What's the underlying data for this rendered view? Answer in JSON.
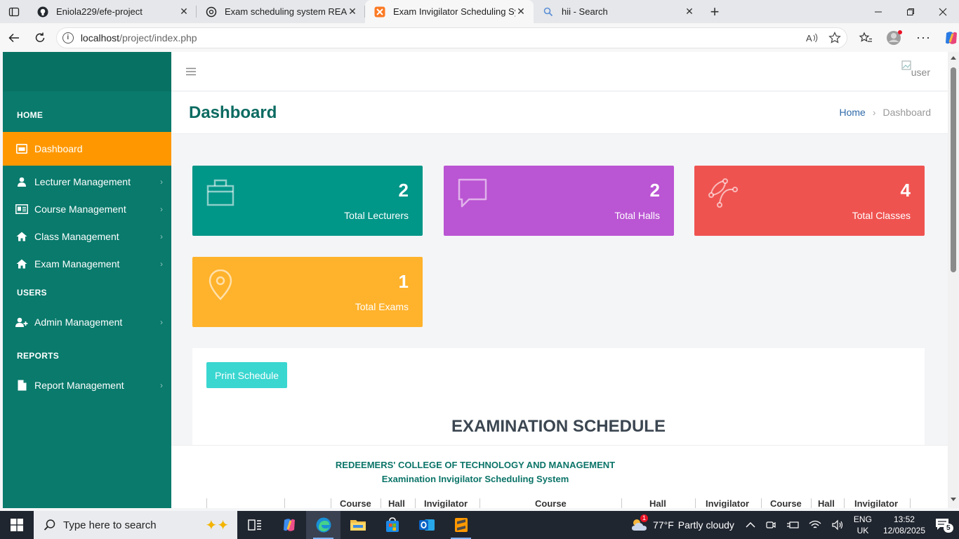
{
  "browser": {
    "tabs": [
      {
        "title": "Eniola229/efe-project",
        "icon": "github-icon"
      },
      {
        "title": "Exam scheduling system README",
        "icon": "openai-icon"
      },
      {
        "title": "Exam Invigilator Scheduling Syste",
        "icon": "xampp-icon",
        "active": true
      },
      {
        "title": "hii - Search",
        "icon": "search-icon"
      }
    ],
    "url_host": "localhost",
    "url_path": "/project/index.php"
  },
  "sidebar": {
    "sections": {
      "home": "HOME",
      "users": "USERS",
      "reports": "REPORTS"
    },
    "items": [
      {
        "label": "Dashboard",
        "icon": "dashboard-icon"
      },
      {
        "label": "Lecturer Management",
        "icon": "user-icon"
      },
      {
        "label": "Course Management",
        "icon": "id-card-icon"
      },
      {
        "label": "Class Management",
        "icon": "home-icon"
      },
      {
        "label": "Exam Management",
        "icon": "home-icon"
      },
      {
        "label": "Admin Management",
        "icon": "user-plus-icon"
      },
      {
        "label": "Report Management",
        "icon": "file-icon"
      }
    ],
    "active_color": "#ff9800",
    "bg_color": "#097a6c"
  },
  "topbar": {
    "avatar_alt": "user"
  },
  "header": {
    "title": "Dashboard",
    "breadcrumb_home": "Home",
    "breadcrumb_current": "Dashboard"
  },
  "stats": [
    {
      "value": "2",
      "label": "Total Lecturers",
      "color": "#009688",
      "icon": "briefcase-icon"
    },
    {
      "value": "2",
      "label": "Total Halls",
      "color": "#ba55d3",
      "icon": "chat-icon"
    },
    {
      "value": "4",
      "label": "Total Classes",
      "color": "#ef5350",
      "icon": "vector-icon"
    },
    {
      "value": "1",
      "label": "Total Exams",
      "color": "#ffb22b",
      "icon": "map-pin-icon"
    }
  ],
  "schedule": {
    "print_label": "Print Schedule",
    "title": "EXAMINATION SCHEDULE",
    "college": "REDEEMERS' COLLEGE OF TECHNOLOGY AND MANAGEMENT",
    "subtitle": "Examination Invigilator Scheduling System",
    "columns": [
      "Course",
      "Hall",
      "Invigilator",
      "Course",
      "Hall",
      "Invigilator",
      "Course",
      "Hall",
      "Invigilator"
    ]
  },
  "taskbar": {
    "search_placeholder": "Type here to search",
    "weather_temp": "77°F",
    "weather_desc": "Partly cloudy",
    "weather_badge": "1",
    "lang_top": "ENG",
    "lang_bottom": "UK",
    "time": "13:52",
    "date": "12/08/2025",
    "notif_count": "5"
  }
}
